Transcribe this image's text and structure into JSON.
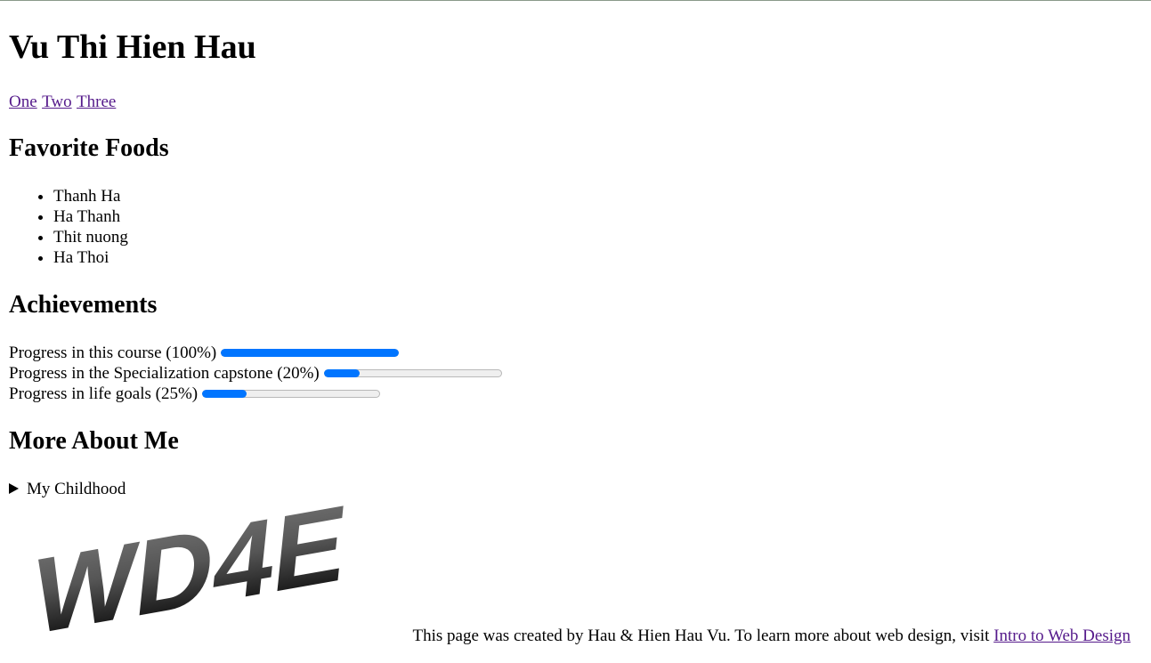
{
  "header": {
    "title": "Vu Thi Hien Hau"
  },
  "nav": {
    "links": [
      "One",
      "Two",
      "Three"
    ]
  },
  "foods": {
    "heading": "Favorite Foods",
    "items": [
      "Thanh Ha",
      "Ha Thanh",
      "Thit nuong",
      "Ha Thoi"
    ]
  },
  "achievements": {
    "heading": "Achievements",
    "items": [
      {
        "label": "Progress in this course (100%)",
        "value": 1.0
      },
      {
        "label": "Progress in the Specialization capstone (20%)",
        "value": 0.2
      },
      {
        "label": "Progress in life goals (25%)",
        "value": 0.25
      }
    ]
  },
  "more": {
    "heading": "More About Me",
    "summary": "My Childhood"
  },
  "logo": {
    "text": "WD4E"
  },
  "footer": {
    "text": "This page was created by Hau & Hien Hau Vu. To learn more about web design, visit ",
    "link": "Intro to Web Design"
  },
  "colors": {
    "progress": "#0075ff",
    "visited_link": "#551a8b"
  }
}
